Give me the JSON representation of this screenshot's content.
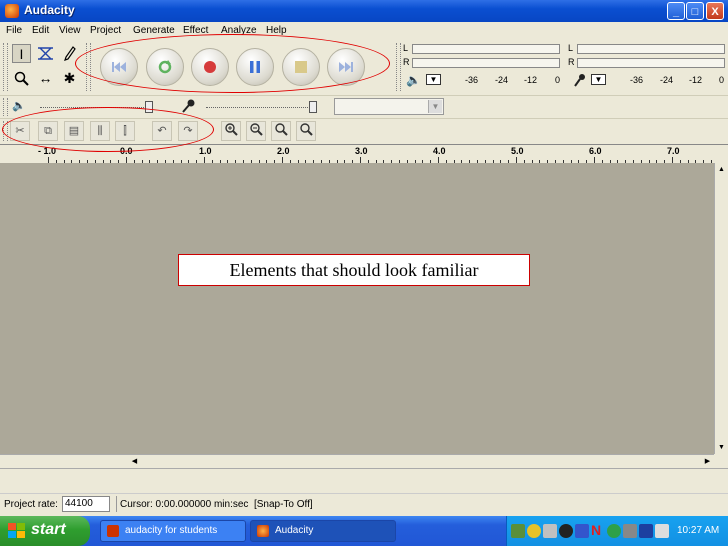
{
  "window": {
    "title": "Audacity"
  },
  "window_controls": {
    "minimize": "_",
    "maximize": "□",
    "close": "X"
  },
  "menu": [
    "File",
    "Edit",
    "View",
    "Project",
    "Generate",
    "Effect",
    "Analyze",
    "Help"
  ],
  "meters": {
    "out_L": "L",
    "out_R": "R",
    "in_L": "L",
    "in_R": "R",
    "out_ticks": [
      "-36",
      "-24",
      "-12",
      "0"
    ],
    "in_ticks": [
      "-36",
      "-24",
      "-12",
      "0"
    ]
  },
  "ruler": {
    "labels": [
      "- 1.0",
      "0.0",
      "1.0",
      "2.0",
      "3.0",
      "4.0",
      "5.0",
      "6.0",
      "7.0"
    ]
  },
  "note": "Elements that should look familiar",
  "status": {
    "project_rate_label": "Project rate:",
    "project_rate_value": "44100",
    "cursor_text": "Cursor: 0:00.000000 min:sec  [Snap-To Off]"
  },
  "taskbar": {
    "start": "start",
    "items": [
      "audacity for students",
      "Audacity"
    ],
    "clock": "10:27 AM"
  },
  "colors": {
    "annotation": "#e00000",
    "track_bg": "#aca899",
    "taskbar": "#245edb"
  }
}
